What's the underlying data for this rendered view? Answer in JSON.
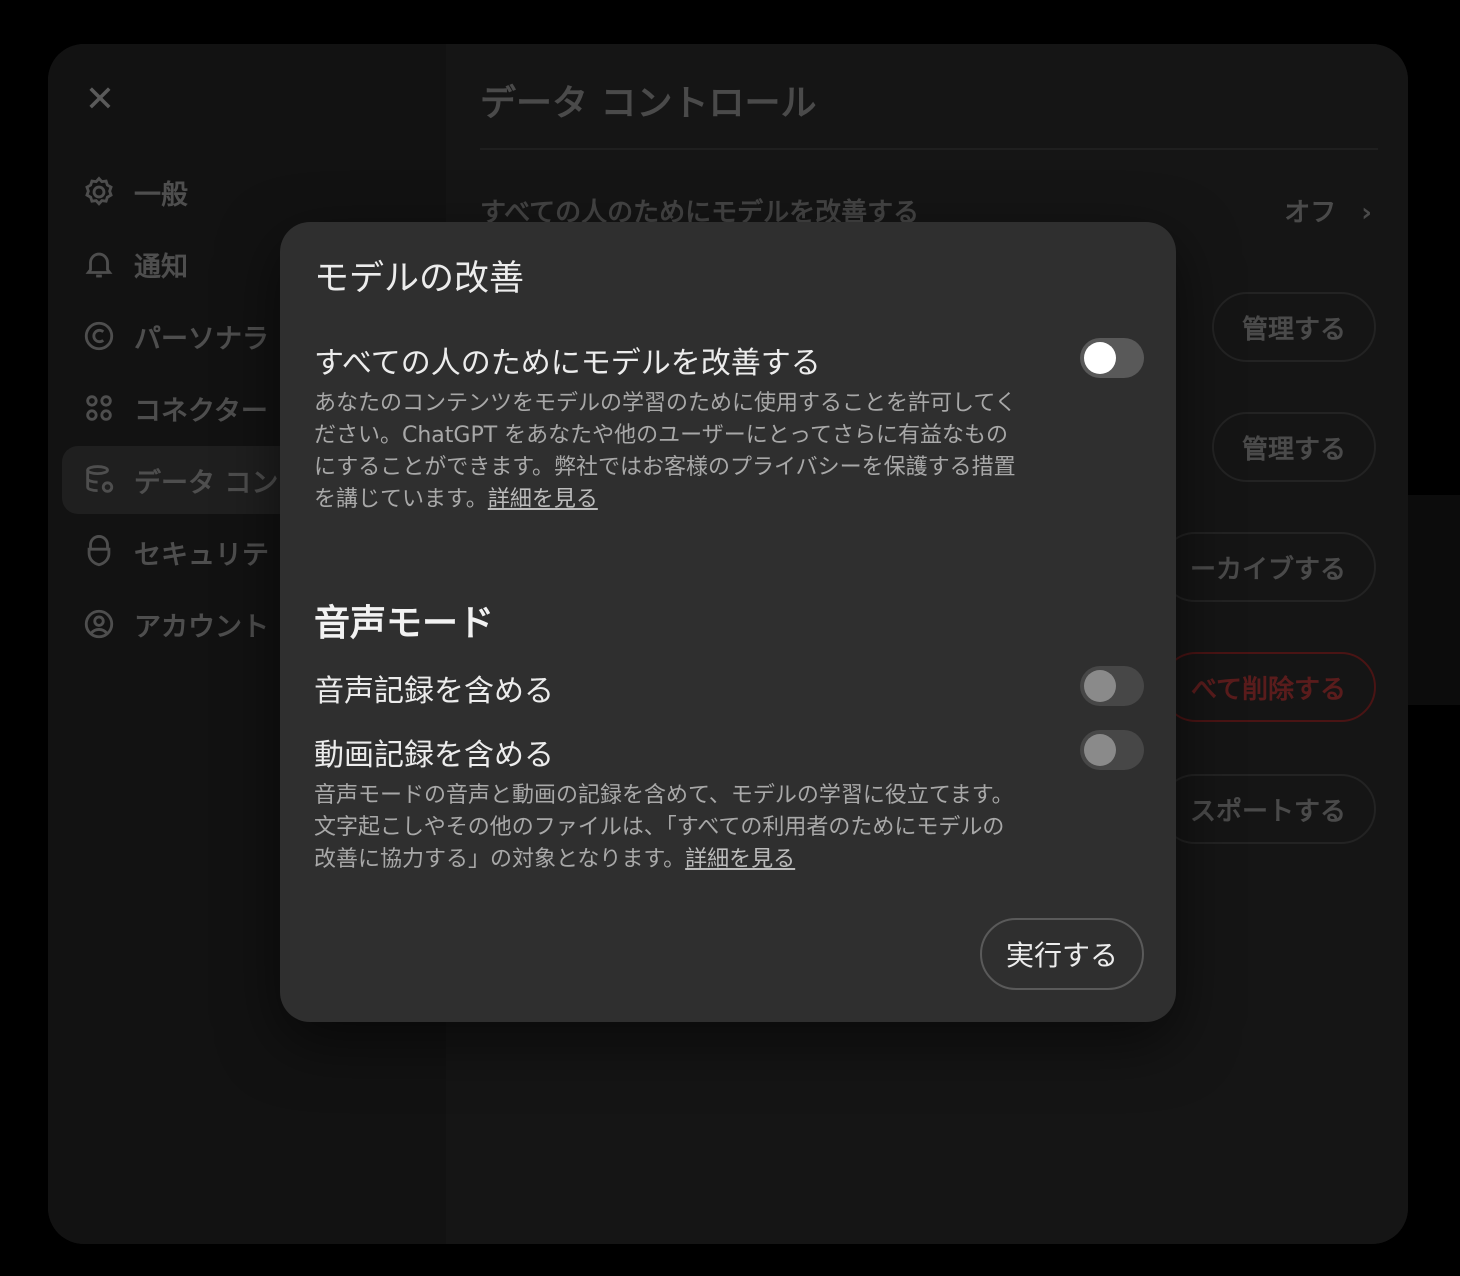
{
  "background_window": {
    "title": "データ コントロール",
    "sidebar": {
      "items": [
        {
          "label": "一般",
          "icon": "gear-icon"
        },
        {
          "label": "通知",
          "icon": "bell-icon"
        },
        {
          "label": "パーソナラ",
          "icon": "personalization-icon"
        },
        {
          "label": "コネクター",
          "icon": "connectors-icon"
        },
        {
          "label": "データ コン",
          "icon": "data-controls-icon"
        },
        {
          "label": "セキュリテ",
          "icon": "security-icon"
        },
        {
          "label": "アカウント",
          "icon": "account-icon"
        }
      ]
    },
    "rows": {
      "improve_label": "すべての人のためにモデルを改善する",
      "improve_value": "オフ",
      "manage_1": "管理する",
      "manage_2": "管理する",
      "archive": "ーカイブする",
      "delete_all": "べて削除する",
      "export": "スポートする"
    }
  },
  "modal": {
    "title": "モデルの改善",
    "improve": {
      "label": "すべての人のためにモデルを改善する",
      "enabled": false,
      "desc": "あなたのコンテンツをモデルの学習のために使用することを許可してください。ChatGPT をあなたや他のユーザーにとってさらに有益なものにすることができます。弊社ではお客様のプライバシーを保護する措置を講じています。",
      "link": "詳細を見る"
    },
    "voice_section": {
      "heading": "音声モード",
      "audio_label": "音声記録を含める",
      "video_label": "動画記録を含める",
      "desc": "音声モードの音声と動画の記録を含めて、モデルの学習に役立てます。文字起こしやその他のファイルは、「すべての利用者のためにモデルの改善に協力する」の対象となります。",
      "link": "詳細を見る"
    },
    "run_button": "実行する"
  },
  "colors": {
    "modal_bg": "#2f2f2f",
    "page_bg": "#000000",
    "danger": "#5a1c1c"
  }
}
